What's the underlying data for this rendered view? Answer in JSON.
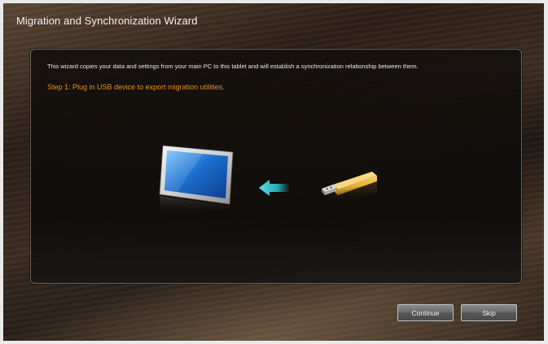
{
  "window": {
    "title": "Migration and Synchronization Wizard"
  },
  "panel": {
    "description": "This wizard copies your data and settings from your main PC to this tablet and will establish a synchronization relationship between them.",
    "step": "Step 1: Plug in USB device to export migration utilities."
  },
  "illustration": {
    "monitor_icon": "tablet-screen-icon",
    "arrow_icon": "arrow-left-icon",
    "usb_icon": "usb-drive-icon",
    "colors": {
      "arrow": "#3fd0d6",
      "usb": "#e7b23a",
      "screen": "#1e6fd0"
    }
  },
  "buttons": {
    "continue_label": "Continue",
    "skip_label": "Skip"
  },
  "colors": {
    "step_text": "#ef8a1e"
  }
}
